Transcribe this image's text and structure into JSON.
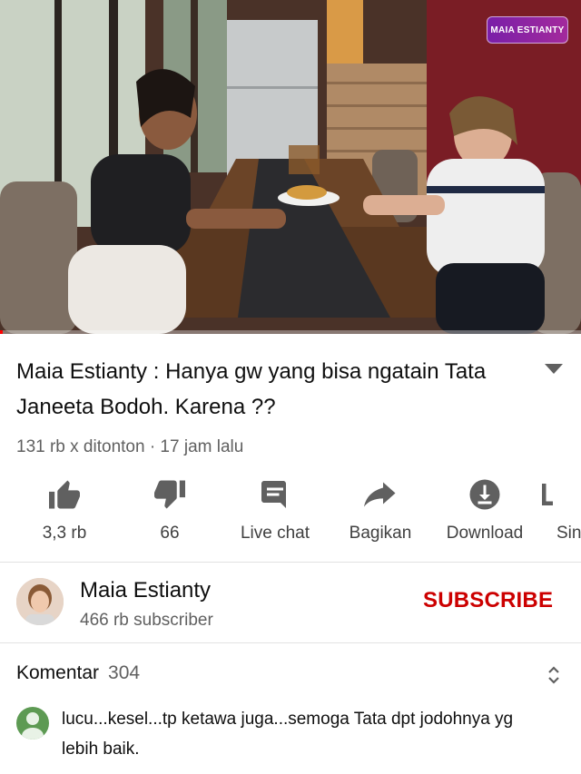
{
  "video": {
    "watermark": "MAIA ESTIANTY",
    "progress_fraction": 0.005
  },
  "title": "Maia Estianty : Hanya gw yang bisa ngatain Tata Janeeta Bodoh. Karena ??",
  "meta": "131 rb x ditonton · 17 jam lalu",
  "actions": [
    {
      "icon": "thumbs-up-icon",
      "label": "3,3 rb"
    },
    {
      "icon": "thumbs-down-icon",
      "label": "66"
    },
    {
      "icon": "live-chat-icon",
      "label": "Live chat"
    },
    {
      "icon": "share-icon",
      "label": "Bagikan"
    },
    {
      "icon": "download-icon",
      "label": "Download"
    },
    {
      "icon": "save-icon",
      "label": "Sin"
    }
  ],
  "channel": {
    "name": "Maia Estianty",
    "subscribers": "466 rb subscriber",
    "subscribe_label": "SUBSCRIBE"
  },
  "comments": {
    "label": "Komentar",
    "count": "304",
    "first_comment": "lucu...kesel...tp ketawa juga...semoga Tata dpt jodohnya yg lebih baik."
  },
  "colors": {
    "subscribe": "#cc0000",
    "progress": "#ff0000",
    "secondary_text": "#606060"
  }
}
